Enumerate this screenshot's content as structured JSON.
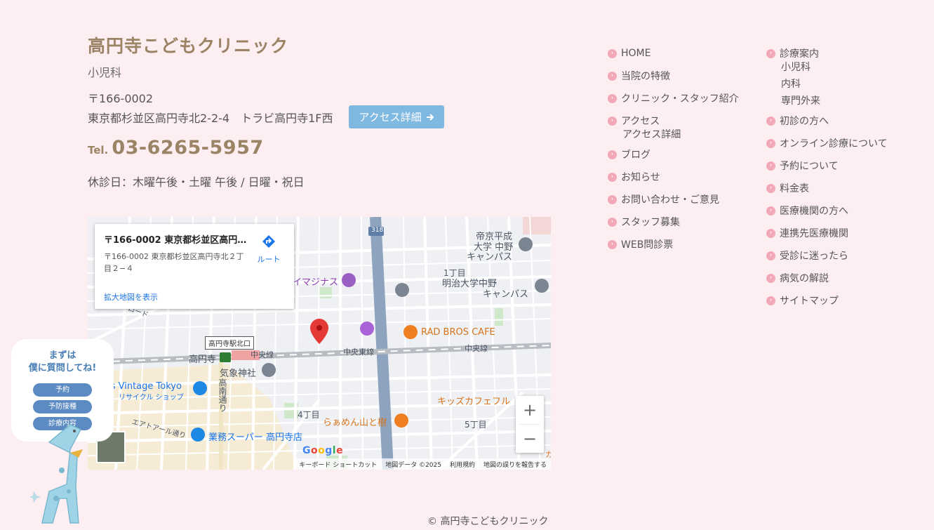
{
  "brand": {
    "name": "高円寺こどもクリニック",
    "subtitle": "小児科"
  },
  "contact": {
    "postal": "〒166-0002",
    "address": "東京都杉並区高円寺北2-2-4　トラビ高円寺1F西",
    "access_button": "アクセス詳細",
    "tel_label": "Tel.",
    "tel_number": "03-6265-5957",
    "holidays": "休診日：木曜午後・土曜 午後 / 日曜・祝日"
  },
  "map": {
    "info_title": "〒166-0002 東京都杉並区高円...",
    "info_address": "〒166-0002 東京都杉並区高円寺北２丁目２−４",
    "route_label": "ルート",
    "larger_map": "拡大地図を表示",
    "zoom_in": "+",
    "zoom_out": "−",
    "google": "Google",
    "footer": {
      "shortcuts": "キーボード ショートカット",
      "data": "地図データ ©2025",
      "terms": "利用規約",
      "report": "地図の誤りを報告する"
    },
    "labels": {
      "teikyo": "帝京平成",
      "teikyo2": "大学 中野",
      "campus": "キャンパス",
      "meiji": "明治大学中野",
      "meiji2": "キャンパス",
      "chome1": "1丁目",
      "imaginas": "イマジナス",
      "radbros": "RAD BROS CAFE",
      "chuo1": "中央線",
      "chuo2": "中央東線",
      "chuo3": "中央線",
      "chuo4": "央線",
      "koenji": "高円寺",
      "station": "高円寺駅北口",
      "kishojinja": "気象神社",
      "vintage": "tis Vintage Tokyo",
      "recycle": "リサイクル ショップ",
      "koenji_dori": "高南通り",
      "chome4": "4丁目",
      "chome5": "5丁目",
      "ramen": "らぁめん山と樹",
      "kids": "キッズカフェフル",
      "gyomu": "業務スーパー 高円寺店",
      "airroad": "エアロード",
      "aeroad2": "エアトアール通り",
      "route318": "318",
      "ka": "カ"
    }
  },
  "nav_col1": [
    {
      "label": "HOME"
    },
    {
      "label": "当院の特徴"
    },
    {
      "label": "クリニック・スタッフ紹介"
    },
    {
      "label": "アクセス",
      "sub": [
        "アクセス詳細"
      ]
    },
    {
      "label": "ブログ"
    },
    {
      "label": "お知らせ"
    },
    {
      "label": "お問い合わせ・ご意見"
    },
    {
      "label": "スタッフ募集"
    },
    {
      "label": "WEB問診票"
    }
  ],
  "nav_col2": [
    {
      "label": "診療案内",
      "sub": [
        "小児科",
        "内科",
        "専門外来"
      ]
    },
    {
      "label": "初診の方へ"
    },
    {
      "label": "オンライン診療について"
    },
    {
      "label": "予約について"
    },
    {
      "label": "料金表"
    },
    {
      "label": "医療機関の方へ"
    },
    {
      "label": "連携先医療機関"
    },
    {
      "label": "受診に迷ったら"
    },
    {
      "label": "病気の解説"
    },
    {
      "label": "サイトマップ"
    }
  ],
  "chat": {
    "line1": "まずは",
    "line2": "僕に質問してね!",
    "btn_reserve": "予約",
    "btn_vaccine": "予防接種",
    "btn_treatment": "診療内容"
  },
  "footer": {
    "copyright": "© 高円寺こどもクリニック"
  },
  "colors": {
    "background": "#fdeef1",
    "brand": "#9b8465",
    "accent": "#7fb8e0",
    "nav_dot": "#f2a8b6"
  }
}
